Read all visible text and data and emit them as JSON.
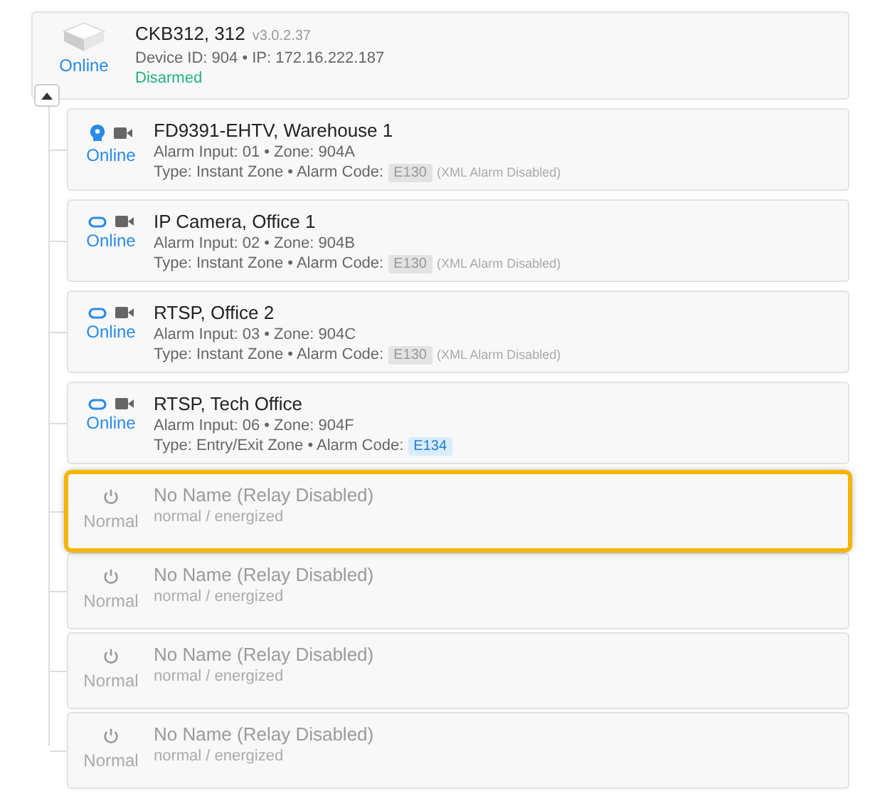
{
  "controller": {
    "name": "CKB312, 312",
    "version": "v3.0.2.37",
    "details": "Device ID: 904 • IP: 172.16.222.187",
    "status": "Online",
    "arm_state": "Disarmed",
    "expanded": true
  },
  "children": [
    {
      "kind": "analytics-zone",
      "name": "FD9391-EHTV, Warehouse 1",
      "status": "Online",
      "line1": "Alarm Input: 01 • Zone: 904A",
      "line2": "Type: Instant Zone • Alarm Code:",
      "code": "E130",
      "code_enabled": false,
      "note": "(XML Alarm Disabled)"
    },
    {
      "kind": "camera-zone",
      "name": "IP Camera, Office 1",
      "status": "Online",
      "line1": "Alarm Input: 02 • Zone: 904B",
      "line2": "Type: Instant Zone • Alarm Code:",
      "code": "E130",
      "code_enabled": false,
      "note": "(XML Alarm Disabled)"
    },
    {
      "kind": "camera-zone",
      "name": "RTSP, Office 2",
      "status": "Online",
      "line1": "Alarm Input: 03 • Zone: 904C",
      "line2": "Type: Instant Zone • Alarm Code:",
      "code": "E130",
      "code_enabled": false,
      "note": "(XML Alarm Disabled)"
    },
    {
      "kind": "camera-zone",
      "name": "RTSP, Tech Office",
      "status": "Online",
      "line1": "Alarm Input: 06 • Zone: 904F",
      "line2": "Type: Entry/Exit Zone • Alarm Code:",
      "code": "E134",
      "code_enabled": true
    },
    {
      "kind": "relay",
      "name": "No Name (Relay Disabled)",
      "status": "Normal",
      "line1": "normal / energized",
      "selected": true
    },
    {
      "kind": "relay",
      "name": "No Name (Relay Disabled)",
      "status": "Normal",
      "line1": "normal / energized",
      "selected": false
    },
    {
      "kind": "relay",
      "name": "No Name (Relay Disabled)",
      "status": "Normal",
      "line1": "normal / energized",
      "selected": false
    },
    {
      "kind": "relay",
      "name": "No Name (Relay Disabled)",
      "status": "Normal",
      "line1": "normal / energized",
      "selected": false
    }
  ]
}
